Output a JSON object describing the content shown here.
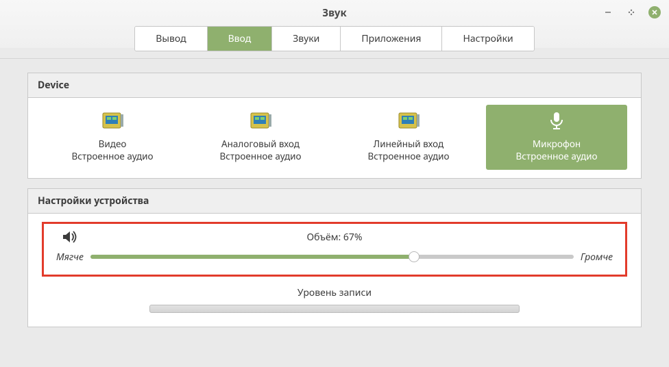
{
  "window": {
    "title": "Звук"
  },
  "tabs": [
    {
      "label": "Вывод",
      "active": false
    },
    {
      "label": "Ввод",
      "active": true
    },
    {
      "label": "Звуки",
      "active": false
    },
    {
      "label": "Приложения",
      "active": false
    },
    {
      "label": "Настройки",
      "active": false
    }
  ],
  "device_section": {
    "title": "Device"
  },
  "devices": [
    {
      "name": "Видео",
      "subtitle": "Встроенное аудио",
      "selected": false,
      "icon": "card"
    },
    {
      "name": "Аналоговый вход",
      "subtitle": "Встроенное аудио",
      "selected": false,
      "icon": "card"
    },
    {
      "name": "Линейный вход",
      "subtitle": "Встроенное аудио",
      "selected": false,
      "icon": "card"
    },
    {
      "name": "Микрофон",
      "subtitle": "Встроенное аудио",
      "selected": true,
      "icon": "mic"
    }
  ],
  "settings_section": {
    "title": "Настройки устройства"
  },
  "volume": {
    "label": "Объём: 67%",
    "percent": 67,
    "softer": "Мягче",
    "louder": "Громче"
  },
  "level": {
    "label": "Уровень записи"
  }
}
